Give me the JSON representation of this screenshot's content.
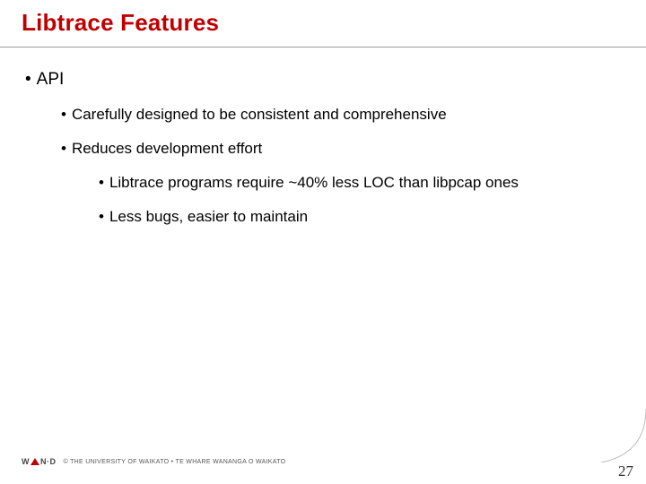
{
  "title": "Libtrace Features",
  "bullets": {
    "b1": "API",
    "b2": "Carefully designed to be consistent and comprehensive",
    "b3": "Reduces development effort",
    "b4": "Libtrace programs require ~40% less LOC than libpcap ones",
    "b5": "Less bugs, easier to maintain"
  },
  "footer": {
    "logo_left": "W",
    "logo_right": "N·D",
    "copyright": "© THE UNIVERSITY OF WAIKATO  •  TE WHARE WANANGA O WAIKATO"
  },
  "page_number": "27"
}
